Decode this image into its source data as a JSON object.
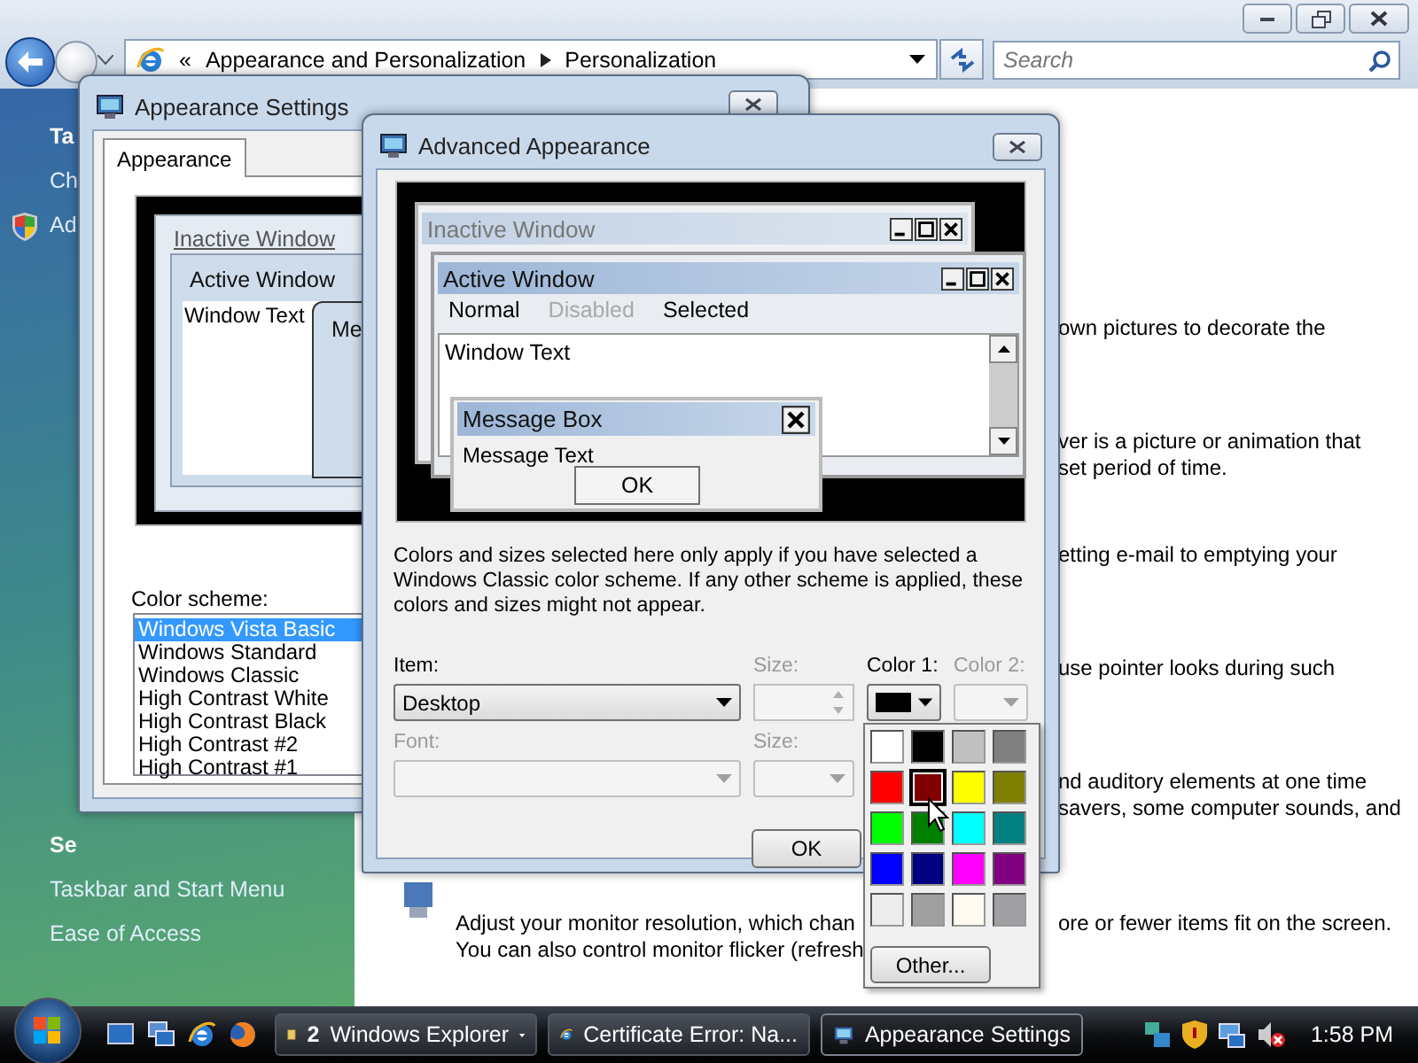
{
  "explorer": {
    "address": {
      "overflow": "«",
      "crumbs": [
        "Appearance and Personalization",
        "Personalization"
      ]
    },
    "search": {
      "placeholder": "Search"
    },
    "sidebar": {
      "tasks_heading": "Ta",
      "tasks": [
        {
          "label": "Ch",
          "shield": false
        },
        {
          "label": "Ad",
          "shield": true
        }
      ],
      "see_also_heading": "Se",
      "see_also": [
        "Taskbar and Start Menu",
        "Ease of Access"
      ]
    },
    "content": {
      "sections": [
        {
          "lines": [
            "own pictures to decorate the"
          ]
        },
        {
          "lines": [
            "ver is a picture or animation that",
            "set period of time."
          ]
        },
        {
          "lines": [
            "etting e-mail to emptying your"
          ]
        },
        {
          "lines": [
            "use pointer looks during such"
          ]
        },
        {
          "lines": [
            "nd auditory elements at one time",
            "savers, some computer sounds, and"
          ]
        }
      ],
      "display": {
        "lines": [
          "Adjust your monitor resolution, which chan",
          "You can also control monitor flicker (refresh"
        ],
        "first_line_end": "ore or fewer items fit on the screen."
      }
    }
  },
  "appearance_settings": {
    "title": "Appearance Settings",
    "tabs": [
      {
        "label": "Appearance",
        "selected": true
      }
    ],
    "preview": {
      "inactive_title": "Inactive Window",
      "active_title": "Active Window",
      "window_text": "Window Text",
      "message_title": "Me"
    },
    "color_scheme_label": "Color scheme:",
    "color_schemes": [
      {
        "label": "Windows Vista Basic",
        "selected": true
      },
      {
        "label": "Windows Standard",
        "selected": false
      },
      {
        "label": "Windows Classic",
        "selected": false
      },
      {
        "label": "High Contrast White",
        "selected": false
      },
      {
        "label": "High Contrast Black",
        "selected": false
      },
      {
        "label": "High Contrast #2",
        "selected": false
      },
      {
        "label": "High Contrast #1",
        "selected": false
      }
    ]
  },
  "advanced_appearance": {
    "title": "Advanced Appearance",
    "preview": {
      "inactive_title": "Inactive Window",
      "active_title": "Active Window",
      "menu": [
        {
          "label": "Normal",
          "kind": "normal"
        },
        {
          "label": "Disabled",
          "kind": "disabled"
        },
        {
          "label": "Selected",
          "kind": "selected"
        }
      ],
      "window_text": "Window Text",
      "message_title": "Message Box",
      "message_text": "Message Text",
      "ok": "OK"
    },
    "note": "Colors and sizes selected here only apply if you have selected a Windows Classic color scheme. If any other scheme is applied, these colors and sizes might not appear.",
    "fields": [
      {
        "label": "Item:",
        "kind": "combo",
        "value": "Desktop",
        "disabled": false
      },
      {
        "label": "Size:",
        "kind": "spinner",
        "disabled": true
      },
      {
        "label": "Color 1:",
        "kind": "color",
        "color": "#000000",
        "disabled": false
      },
      {
        "label": "Color 2:",
        "kind": "color",
        "disabled": true
      },
      {
        "label": "Font:",
        "kind": "combo",
        "disabled": true
      },
      {
        "label": "Size:",
        "kind": "combo",
        "disabled": true
      }
    ],
    "ok_button": "OK",
    "palette": {
      "swatches": [
        {
          "color": "#ffffff",
          "selected": false
        },
        {
          "color": "#000000",
          "selected": false
        },
        {
          "color": "#c0c0c0",
          "selected": false
        },
        {
          "color": "#808080",
          "selected": false
        },
        {
          "color": "#ff0000",
          "selected": false
        },
        {
          "color": "#800000",
          "selected": true
        },
        {
          "color": "#ffff00",
          "selected": false
        },
        {
          "color": "#808000",
          "selected": false
        },
        {
          "color": "#00ff00",
          "selected": false
        },
        {
          "color": "#008000",
          "selected": false
        },
        {
          "color": "#00ffff",
          "selected": false
        },
        {
          "color": "#008080",
          "selected": false
        },
        {
          "color": "#0000ff",
          "selected": false
        },
        {
          "color": "#000080",
          "selected": false
        },
        {
          "color": "#ff00ff",
          "selected": false
        },
        {
          "color": "#800080",
          "selected": false
        },
        {
          "color": "#ececec",
          "selected": false
        },
        {
          "color": "#a0a0a0",
          "selected": false
        },
        {
          "color": "#fffbf0",
          "selected": false
        },
        {
          "color": "#a0a0a4",
          "selected": false
        }
      ],
      "other_button": "Other..."
    }
  },
  "taskbar": {
    "tasks": [
      {
        "kind": "folder",
        "count": "2",
        "label": "Windows Explorer",
        "selected": false
      },
      {
        "kind": "browser",
        "label": "Certificate Error: Na...",
        "selected": false
      },
      {
        "kind": "display",
        "label": "Appearance Settings",
        "selected": true
      }
    ],
    "clock": "1:58 PM"
  }
}
